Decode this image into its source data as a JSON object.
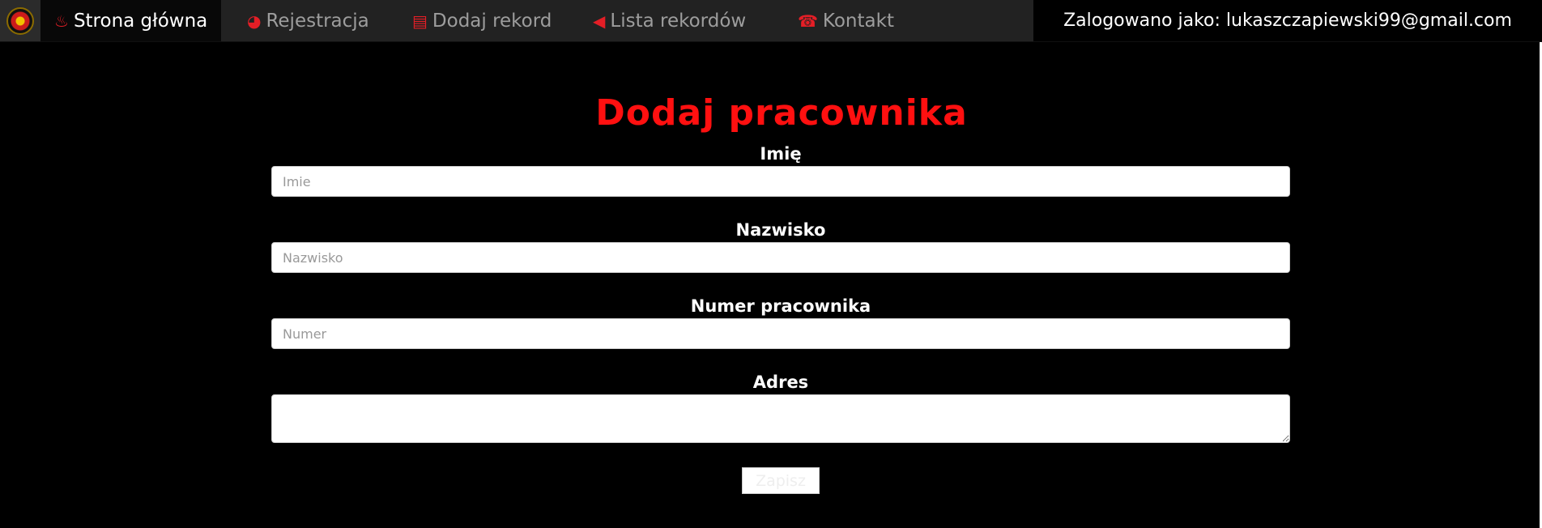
{
  "nav": {
    "items": [
      {
        "label": "Strona główna",
        "icon": "fire-icon",
        "glyph": "♨",
        "active": true
      },
      {
        "label": "Rejestracja",
        "icon": "globe-icon",
        "glyph": "◕",
        "active": false
      },
      {
        "label": "Dodaj rekord",
        "icon": "list-icon",
        "glyph": "▤",
        "active": false
      },
      {
        "label": "Lista rekordów",
        "icon": "megaphone-icon",
        "glyph": "◀",
        "active": false
      },
      {
        "label": "Kontakt",
        "icon": "phone-icon",
        "glyph": "☎",
        "active": false
      }
    ],
    "logged_in": "Zalogowano jako: lukaszczapiewski99@gmail.com"
  },
  "form": {
    "title": "Dodaj pracownika",
    "first_name": {
      "label": "Imię",
      "placeholder": "Imie"
    },
    "last_name": {
      "label": "Nazwisko",
      "placeholder": "Nazwisko"
    },
    "employee_number": {
      "label": "Numer pracownika",
      "placeholder": "Numer"
    },
    "address": {
      "label": "Adres",
      "placeholder": ""
    },
    "save_label": "Zapisz"
  },
  "colors": {
    "accent": "#ff1010",
    "navbar": "#222222",
    "background": "#000000"
  }
}
